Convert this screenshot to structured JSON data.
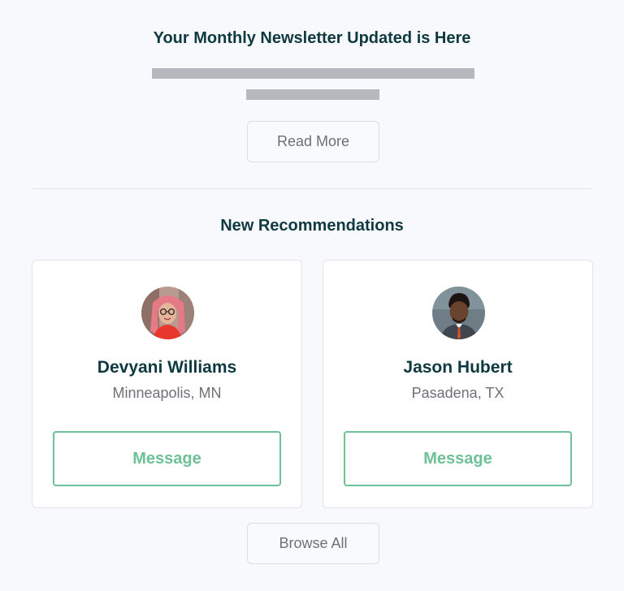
{
  "newsletter": {
    "title": "Your Monthly Newsletter Updated is Here",
    "read_more_label": "Read More"
  },
  "recommendations": {
    "title": "New Recommendations",
    "people": [
      {
        "name": "Devyani Williams",
        "location": "Minneapolis, MN",
        "message_label": "Message",
        "avatar": "avatar-photo-woman"
      },
      {
        "name": "Jason Hubert",
        "location": "Pasadena, TX",
        "message_label": "Message",
        "avatar": "avatar-photo-man"
      }
    ],
    "browse_all_label": "Browse All"
  },
  "colors": {
    "heading": "#0f3940",
    "muted_text": "#6d7177",
    "accent_green": "#6cc195",
    "placeholder_gray": "#b5b9be",
    "background": "#f7f9fc"
  }
}
